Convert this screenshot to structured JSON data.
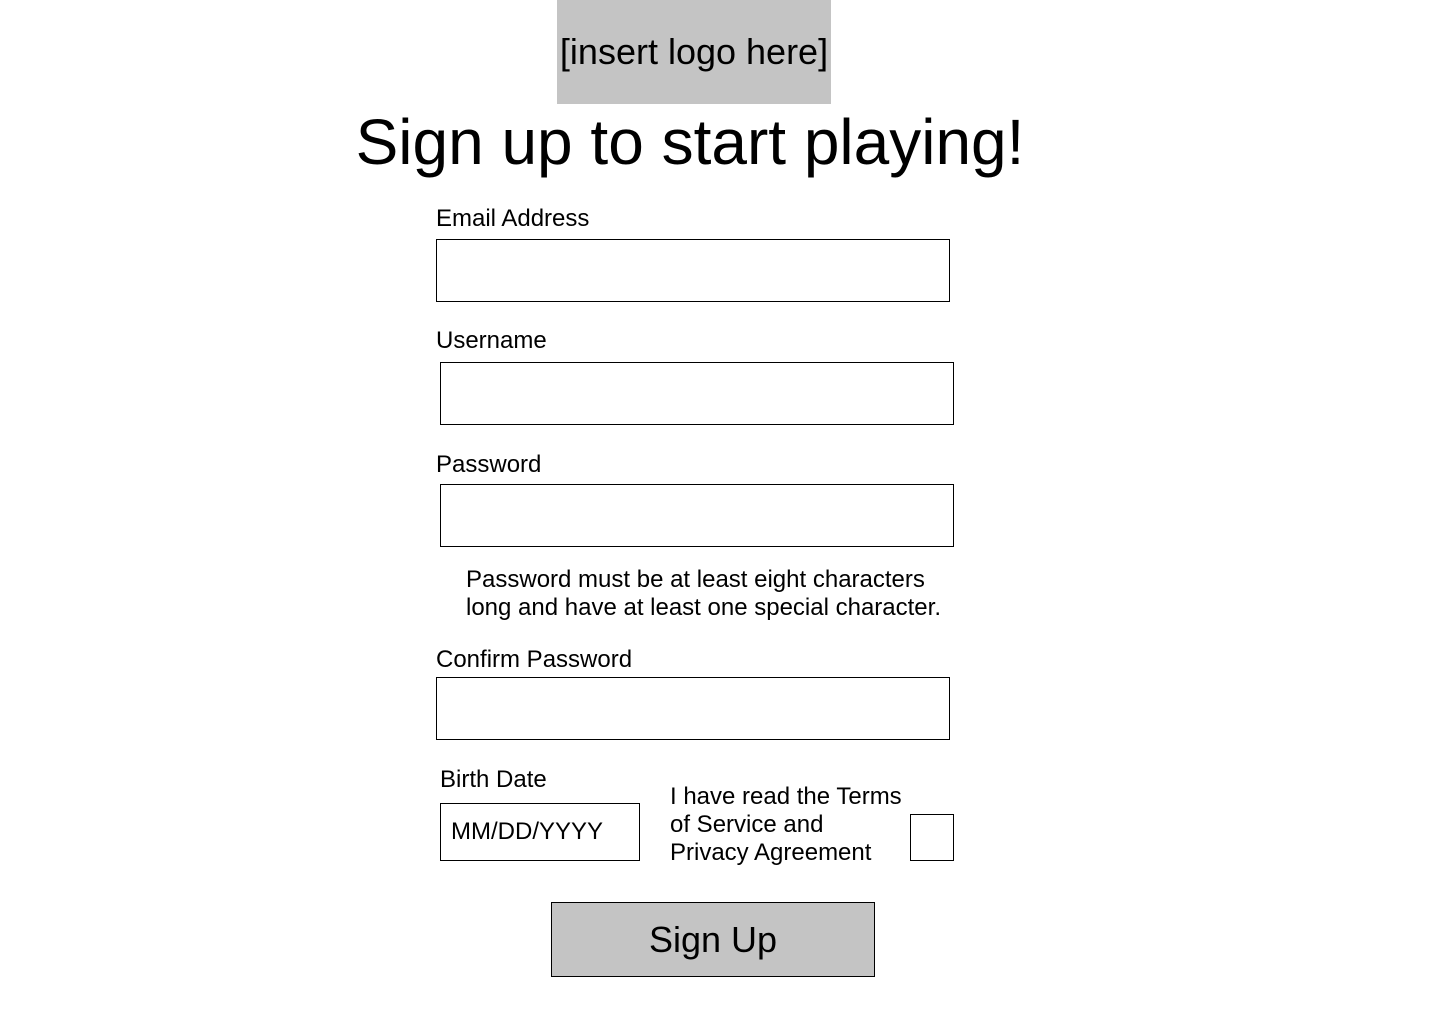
{
  "logo": {
    "text": "[insert logo here]"
  },
  "heading": "Sign up to start playing!",
  "form": {
    "email_label": "Email Address",
    "email_value": "",
    "username_label": "Username",
    "username_value": "",
    "password_label": "Password",
    "password_value": "",
    "password_hint": "Password must be at least eight characters long and have at least one special character.",
    "confirm_label": "Confirm Password",
    "confirm_value": "",
    "birth_label": "Birth Date",
    "birth_placeholder": "MM/DD/YYYY",
    "terms_text": "I have read the Terms of Service and Privacy Agreement",
    "terms_checked": false,
    "submit_label": "Sign Up"
  },
  "colors": {
    "logo_background": "#c4c4c4",
    "button_background": "#c4c4c4",
    "border": "#000000"
  }
}
